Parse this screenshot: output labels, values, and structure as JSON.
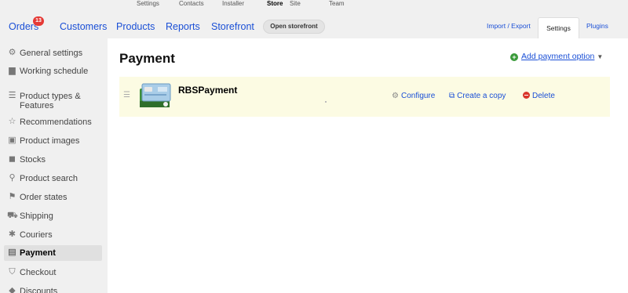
{
  "top_nav": [
    "Settings",
    "Contacts",
    "Installer",
    "Store",
    "Site",
    "Team"
  ],
  "top_nav_active": "Store",
  "main_nav": {
    "orders": "Orders",
    "orders_badge": "13",
    "customers": "Customers",
    "products": "Products",
    "reports": "Reports",
    "storefront": "Storefront",
    "open_storefront": "Open storefront",
    "import_export": "Import / Export",
    "settings": "Settings",
    "plugins": "Plugins"
  },
  "sidebar": {
    "items": [
      {
        "label": "General settings",
        "icon": "sliders-icon",
        "glyph": "⚙"
      },
      {
        "label": "Working schedule",
        "icon": "calendar-icon",
        "glyph": "▆"
      },
      {
        "label": "Product types & Features",
        "icon": "list-icon",
        "glyph": "☰"
      },
      {
        "label": "Recommendations",
        "icon": "star-icon",
        "glyph": "☆"
      },
      {
        "label": "Product images",
        "icon": "camera-icon",
        "glyph": "▣"
      },
      {
        "label": "Stocks",
        "icon": "box-icon",
        "glyph": "◼"
      },
      {
        "label": "Product search",
        "icon": "search-icon",
        "glyph": "⚲"
      },
      {
        "label": "Order states",
        "icon": "flag-icon",
        "glyph": "⚑"
      },
      {
        "label": "Shipping",
        "icon": "truck-icon",
        "glyph": "⛟"
      },
      {
        "label": "Couriers",
        "icon": "walking-man-icon",
        "glyph": "✱"
      },
      {
        "label": "Payment",
        "icon": "wallet-icon",
        "glyph": "▤"
      },
      {
        "label": "Checkout",
        "icon": "cart-icon",
        "glyph": "⛉"
      },
      {
        "label": "Discounts",
        "icon": "tag-icon",
        "glyph": "◆"
      }
    ],
    "active": "Payment"
  },
  "content": {
    "title": "Payment",
    "add_option": "Add payment option",
    "payments": [
      {
        "name": "RBSPayment",
        "actions": {
          "configure": "Configure",
          "copy": "Create a copy",
          "delete": "Delete"
        }
      }
    ]
  },
  "colors": {
    "link": "#1a4fd6",
    "badge": "#e53935",
    "row_highlight": "#fcfbe3",
    "add_icon": "#3a9a3a",
    "delete_icon": "#d9362b"
  }
}
